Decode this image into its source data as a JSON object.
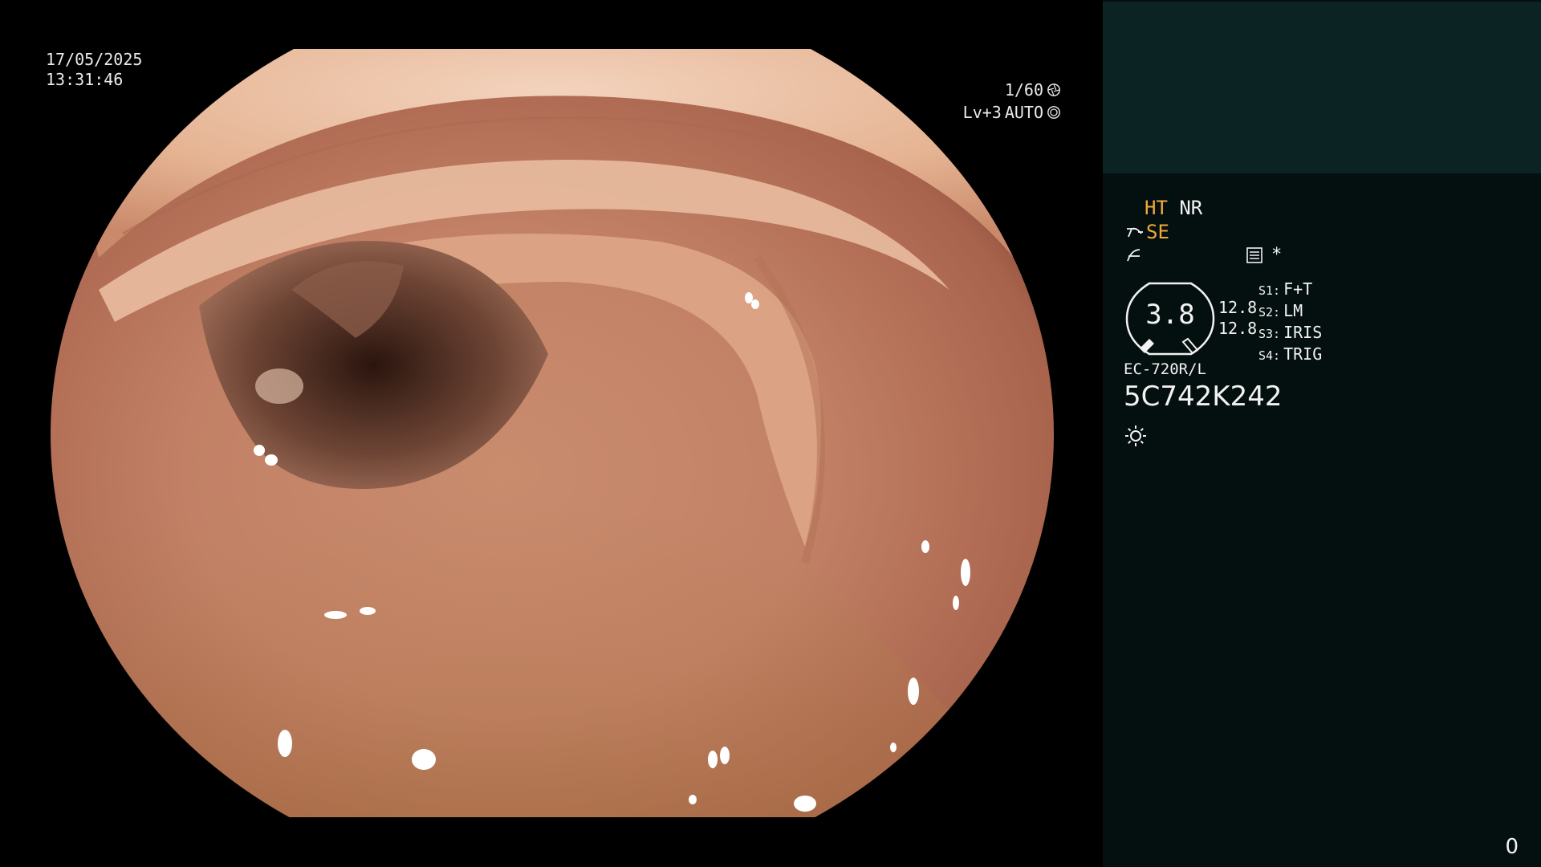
{
  "overlay": {
    "date": "17/05/2025",
    "time": "13:31:46",
    "shutter": "1/60",
    "exposure_level": "Lv+3",
    "exposure_mode": "AUTO",
    "shutter_icon": "aperture-icon",
    "auto_icon": "auto-exposure-icon"
  },
  "panel": {
    "mode_ht": "HT",
    "mode_nr": "NR",
    "mode_se": "SE",
    "sensor_icon": "structure-enhancement-icon",
    "curve_icon": "tone-curve-icon",
    "settings_icon": "settings-list-icon",
    "asterisk": "*",
    "gauge_value": "3.8",
    "readout_1": "12.8",
    "readout_2": "12.8",
    "switches": [
      {
        "key": "S1:",
        "value": "F+T"
      },
      {
        "key": "S2:",
        "value": "LM"
      },
      {
        "key": "S3:",
        "value": "IRIS"
      },
      {
        "key": "S4:",
        "value": "TRIG"
      }
    ],
    "scope_model": "EC-720R/L",
    "scope_serial": "5C742K242",
    "light_icon": "light-source-icon",
    "frame_counter": "0"
  },
  "colors": {
    "panel_bg": "#04100f",
    "panel_top_bg": "#0c2324",
    "accent_orange": "#f2a93b",
    "text_white": "#f2f2f2"
  }
}
